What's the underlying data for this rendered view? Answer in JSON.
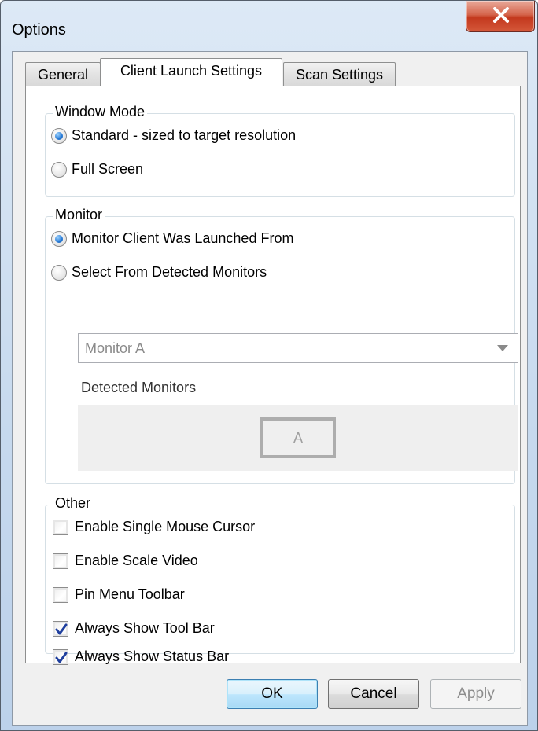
{
  "window": {
    "title": "Options"
  },
  "tabs": [
    {
      "label": "General",
      "active": false
    },
    {
      "label": "Client Launch Settings",
      "active": true
    },
    {
      "label": "Scan Settings",
      "active": false
    }
  ],
  "window_mode": {
    "label": "Window Mode",
    "options": [
      {
        "label": "Standard - sized to target resolution",
        "selected": true
      },
      {
        "label": "Full Screen",
        "selected": false
      }
    ]
  },
  "monitor": {
    "label": "Monitor",
    "options": [
      {
        "label": "Monitor Client Was Launched From",
        "selected": true
      },
      {
        "label": "Select From Detected Monitors",
        "selected": false
      }
    ],
    "select_value": "Monitor A",
    "detected_label": "Detected Monitors",
    "detected": [
      "A"
    ]
  },
  "other": {
    "label": "Other",
    "checks": [
      {
        "label": "Enable Single Mouse Cursor",
        "checked": false
      },
      {
        "label": "Enable Scale Video",
        "checked": false
      },
      {
        "label": "Pin Menu Toolbar",
        "checked": false
      },
      {
        "label": "Always Show Tool Bar",
        "checked": true
      },
      {
        "label": "Always Show Status Bar",
        "checked": true
      }
    ]
  },
  "buttons": {
    "ok": "OK",
    "cancel": "Cancel",
    "apply": "Apply"
  },
  "colors": {
    "accent": "#2478d4",
    "check": "#1f3f9e"
  },
  "icons": {
    "close": "close-icon",
    "dropdown": "chevron-down-icon",
    "check": "checkmark-icon"
  }
}
